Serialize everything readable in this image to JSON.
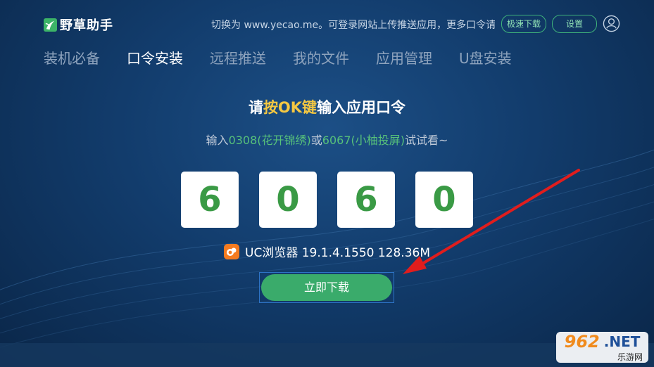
{
  "header": {
    "app_name": "野草助手",
    "notice": "切换为 www.yecao.me。可登录网站上传推送应用，更多口令请",
    "fast_download_label": "极速下载",
    "settings_label": "设置"
  },
  "nav": {
    "items": [
      {
        "label": "装机必备"
      },
      {
        "label": "口令安装"
      },
      {
        "label": "远程推送"
      },
      {
        "label": "我的文件"
      },
      {
        "label": "应用管理"
      },
      {
        "label": "U盘安装"
      }
    ],
    "active_index": 1
  },
  "main": {
    "title_pre": "请",
    "title_highlight": "按OK键",
    "title_post": "输入应用口令",
    "hint_pre": "输入",
    "hint_example1": "0308(花开锦绣)",
    "hint_mid": "或",
    "hint_example2": "6067(小柚投屏)",
    "hint_post": "试试看~",
    "code_digits": [
      "6",
      "0",
      "6",
      "0"
    ],
    "app_info": "UC浏览器 19.1.4.1550 128.36M",
    "download_label": "立即下载"
  },
  "watermark": {
    "number": "962",
    "domain": ".NET",
    "sub": "乐游网"
  },
  "colors": {
    "accent_green": "#3aab6b",
    "highlight_yellow": "#f5c842",
    "code_digit_green": "#3a9a45",
    "annotation_red": "#e11d1d"
  },
  "icons": {
    "logo": "grass-leaf-icon",
    "user": "user-icon",
    "app": "uc-browser-icon",
    "annotation": "red-arrow"
  }
}
